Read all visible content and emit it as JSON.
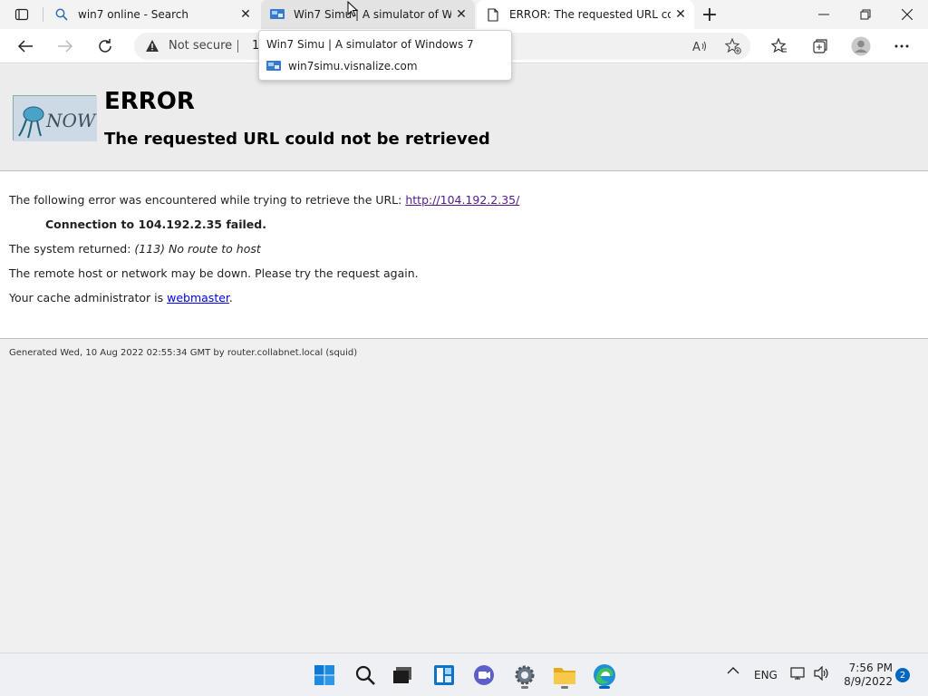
{
  "tabs": [
    {
      "title": "win7 online - Search",
      "icon": "search-icon"
    },
    {
      "title": "Win7 Simu | A simulator of Windows 7",
      "icon": "win7-favicon-icon"
    },
    {
      "title": "ERROR: The requested URL could not be retrieved",
      "icon": "page-icon"
    }
  ],
  "tooltip": {
    "title": "Win7 Simu | A simulator of Windows 7",
    "url": "win7simu.visnalize.com"
  },
  "address_bar": {
    "security_label": "Not secure",
    "url_partial": "1"
  },
  "page": {
    "heading": "ERROR",
    "subheading": "The requested URL could not be retrieved",
    "line1_prefix": "The following error was encountered while trying to retrieve the URL: ",
    "line1_link": "http://104.192.2.35/",
    "line2": "Connection to 104.192.2.35 failed.",
    "line3_prefix": "The system returned: ",
    "line3_value": "(113) No route to host",
    "line4": "The remote host or network may be down. Please try the request again.",
    "line5_prefix": "Your cache administrator is ",
    "line5_link": "webmaster",
    "line5_suffix": ".",
    "footer": "Generated Wed, 10 Aug 2022 02:55:34 GMT by router.collabnet.local (squid)"
  },
  "taskbar": {
    "language": "ENG",
    "time": "7:56 PM",
    "date": "8/9/2022",
    "notification_count": "2",
    "apps": [
      "start-icon",
      "search-icon",
      "task-view-icon",
      "widgets-icon",
      "chat-icon",
      "settings-icon",
      "file-explorer-icon",
      "edge-icon"
    ]
  },
  "colors": {
    "accent": "#0067c0",
    "link_visited": "#551a8b",
    "link": "#0000ee"
  }
}
